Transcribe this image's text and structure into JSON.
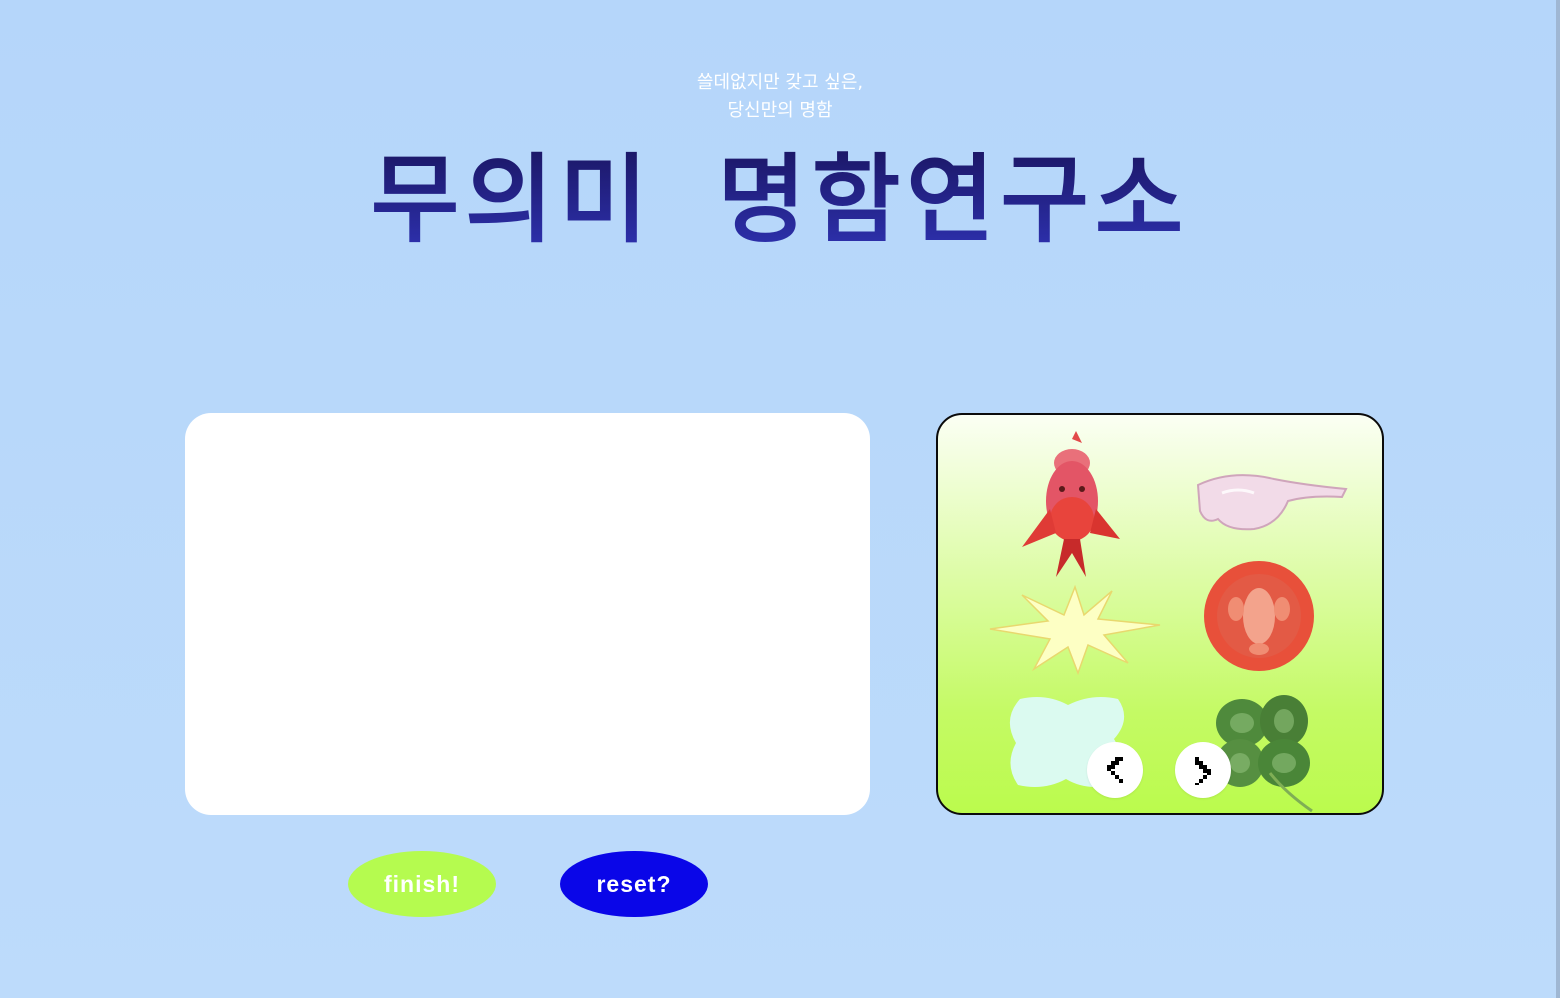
{
  "header": {
    "tagline_line1": "쓸데없지만 갖고 싶은,",
    "tagline_line2": "당신만의 명함",
    "title": "무의미 명함연구소"
  },
  "sticker_panel": {
    "stickers": [
      {
        "name": "goldfish"
      },
      {
        "name": "pink-safety-glasses"
      },
      {
        "name": "yellow-starburst"
      },
      {
        "name": "tomato-slice"
      },
      {
        "name": "mint-cloud"
      },
      {
        "name": "four-leaf-clover"
      }
    ],
    "prev_icon": "chevron-left-icon",
    "next_icon": "chevron-right-icon"
  },
  "actions": {
    "finish_label": "finish!",
    "reset_label": "reset?"
  },
  "colors": {
    "background": "#b5d6fa",
    "title_dark": "#1a1560",
    "title_light": "#2f33b5",
    "finish": "#b5fb4f",
    "reset": "#0a06e8",
    "panel_green": "#bbfb4d"
  }
}
